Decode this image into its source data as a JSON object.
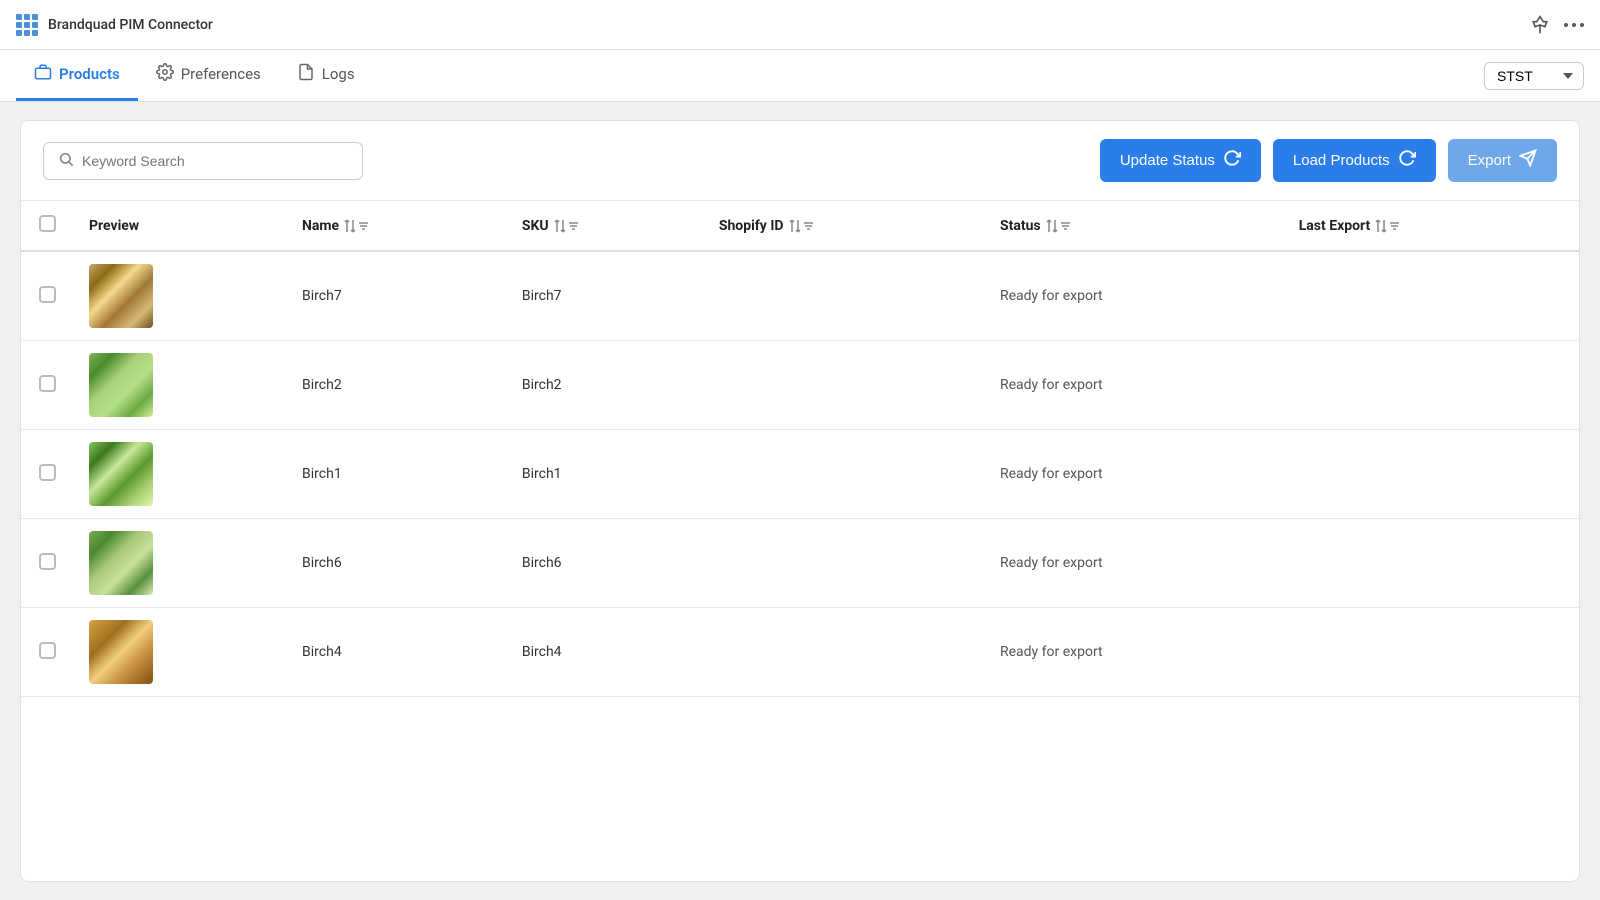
{
  "app": {
    "title": "Brandquad PIM Connector"
  },
  "topbar": {
    "pin_icon": "📌",
    "more_icon": "•••"
  },
  "nav": {
    "tabs": [
      {
        "id": "products",
        "label": "Products",
        "icon": "🛍",
        "active": true
      },
      {
        "id": "preferences",
        "label": "Preferences",
        "icon": "⚙",
        "active": false
      },
      {
        "id": "logs",
        "label": "Logs",
        "icon": "📄",
        "active": false
      }
    ],
    "store_selector": {
      "value": "STST",
      "options": [
        "STST"
      ]
    }
  },
  "toolbar": {
    "search_placeholder": "Keyword Search",
    "update_status_label": "Update Status",
    "load_products_label": "Load Products",
    "export_label": "Export"
  },
  "table": {
    "columns": [
      {
        "id": "checkbox",
        "label": ""
      },
      {
        "id": "preview",
        "label": "Preview",
        "sortable": false,
        "filterable": false
      },
      {
        "id": "name",
        "label": "Name",
        "sortable": true,
        "filterable": true
      },
      {
        "id": "sku",
        "label": "SKU",
        "sortable": true,
        "filterable": true
      },
      {
        "id": "shopify_id",
        "label": "Shopify ID",
        "sortable": true,
        "filterable": true
      },
      {
        "id": "status",
        "label": "Status",
        "sortable": true,
        "filterable": true
      },
      {
        "id": "last_export",
        "label": "Last Export",
        "sortable": true,
        "filterable": true
      }
    ],
    "rows": [
      {
        "id": 1,
        "name": "Birch7",
        "sku": "Birch7",
        "shopify_id": "",
        "status": "Ready for export",
        "last_export": "",
        "img_class": "birch7-img"
      },
      {
        "id": 2,
        "name": "Birch2",
        "sku": "Birch2",
        "shopify_id": "",
        "status": "Ready for export",
        "last_export": "",
        "img_class": "birch2-img"
      },
      {
        "id": 3,
        "name": "Birch1",
        "sku": "Birch1",
        "shopify_id": "",
        "status": "Ready for export",
        "last_export": "",
        "img_class": "birch1-img"
      },
      {
        "id": 4,
        "name": "Birch6",
        "sku": "Birch6",
        "shopify_id": "",
        "status": "Ready for export",
        "last_export": "",
        "img_class": "birch6-img"
      },
      {
        "id": 5,
        "name": "Birch4",
        "sku": "Birch4",
        "shopify_id": "",
        "status": "Ready for export",
        "last_export": "",
        "img_class": "birch4-img"
      }
    ]
  }
}
